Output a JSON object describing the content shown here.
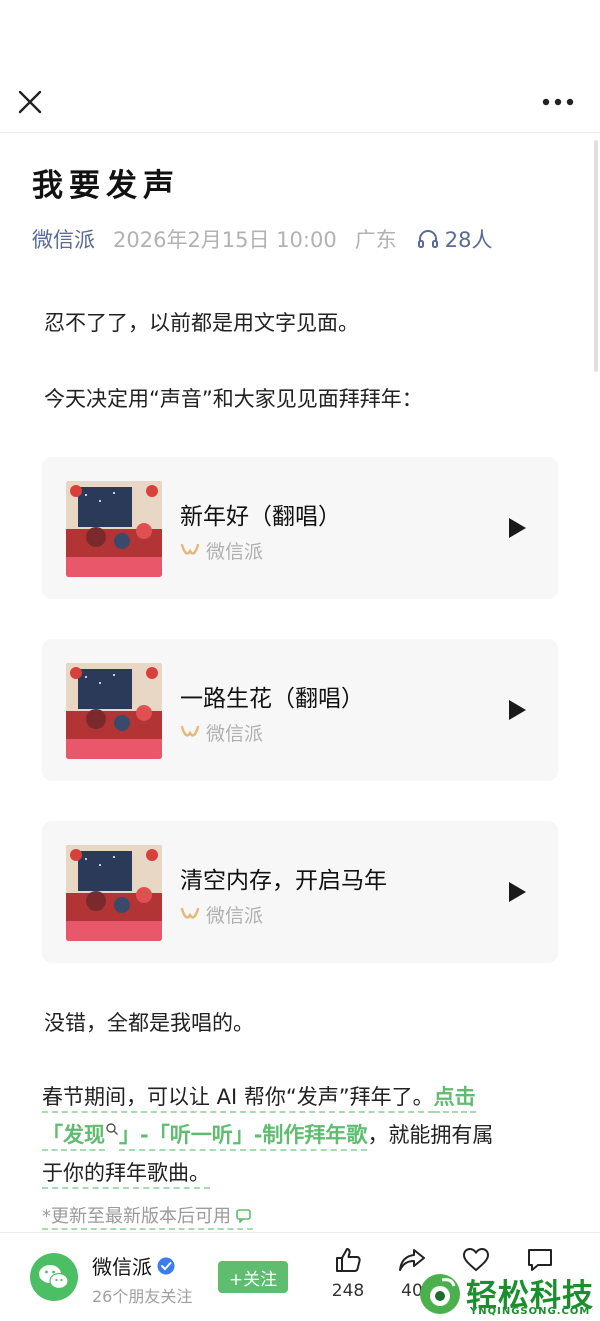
{
  "article": {
    "title": "我要发声",
    "author": "微信派",
    "date": "2026年2月15日 10:00",
    "location": "广东",
    "listeners": "28人"
  },
  "paragraphs": [
    "忍不了了，以前都是用文字见面。",
    "今天决定用“声音”和大家见见面拜拜年："
  ],
  "songs": [
    {
      "title": "新年好（翻唱）",
      "source": "微信派"
    },
    {
      "title": "一路生花（翻唱）",
      "source": "微信派"
    },
    {
      "title": "清空内存，开启马年",
      "source": "微信派"
    }
  ],
  "after_songs": "没错，全都是我唱的。",
  "rich": {
    "text1": "春节期间，可以让 AI 帮你“发声”拜年了。",
    "link1": "点击",
    "link2": "「发现",
    "link3": "」-「听一听」-制作拜年歌",
    "text2": "，就能拥有属",
    "text3": "于你的拜年歌曲。"
  },
  "note": "*更新至最新版本后可用",
  "bottom": {
    "account_name": "微信派",
    "account_sub": "26个朋友关注",
    "follow_label": "+关注",
    "likes": "248",
    "shares": "40"
  },
  "watermark": {
    "text": "轻松科技",
    "sub": "YNQINGSONG.COM"
  },
  "colors": {
    "link_green": "#5ebd6f",
    "author_blue": "#576b95"
  },
  "icons": [
    "close-icon",
    "more-icon",
    "headphones-icon",
    "play-icon",
    "verified-icon",
    "thumb-up-icon",
    "share-icon",
    "heart-icon",
    "comment-icon",
    "search-icon"
  ]
}
